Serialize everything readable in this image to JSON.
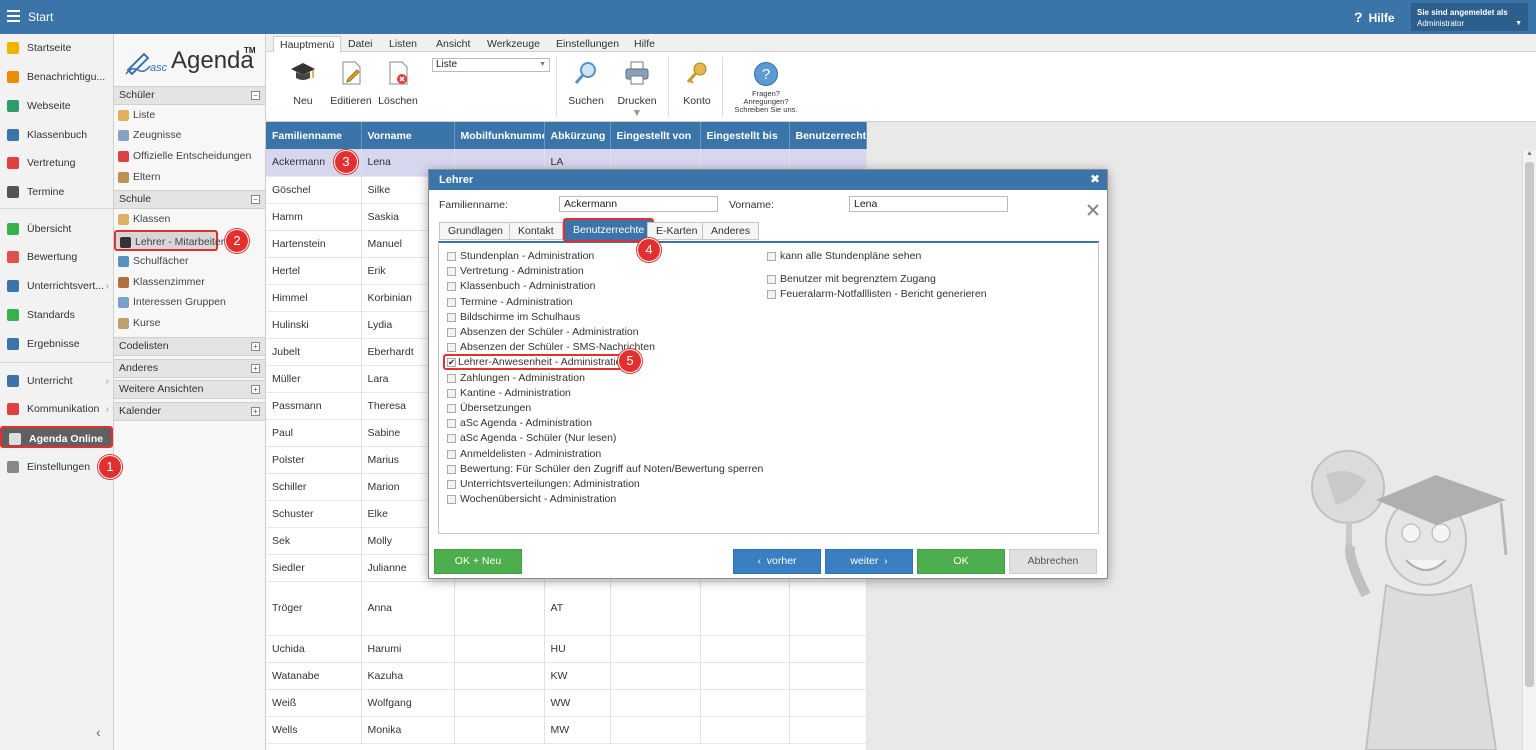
{
  "topbar": {
    "title": "Start",
    "help": "Hilfe",
    "login_caption": "Sie sind angemeldet als",
    "login_user": "Administrator"
  },
  "leftnav": {
    "items": [
      {
        "label": "Startseite",
        "color": "#f0b400"
      },
      {
        "label": "Benachrichtigu...",
        "color": "#f08c00"
      },
      {
        "label": "Webseite",
        "color": "#2e9c6a"
      },
      {
        "label": "Klassenbuch",
        "color": "#3b74a9"
      },
      {
        "label": "Vertretung",
        "color": "#e04040"
      },
      {
        "label": "Termine",
        "color": "#555555"
      },
      {
        "label": "Übersicht",
        "color": "#3ab04a"
      },
      {
        "label": "Bewertung",
        "color": "#e05050"
      },
      {
        "label": "Unterrichtsvert...",
        "color": "#3b74a9"
      },
      {
        "label": "Standards",
        "color": "#3ab04a"
      },
      {
        "label": "Ergebnisse",
        "color": "#3b74a9"
      },
      {
        "label": "Unterricht",
        "color": "#3b74a9"
      },
      {
        "label": "Kommunikation",
        "color": "#e04040"
      },
      {
        "label": "Agenda Online",
        "color": "#dddddd"
      },
      {
        "label": "Einstellungen",
        "color": "#888888"
      }
    ]
  },
  "subnav": {
    "logo_asc": "asc",
    "logo_agenda": "Agenda",
    "logo_tm": "TM",
    "sections": {
      "schueler": "Schüler",
      "schule": "Schule",
      "codelisten": "Codelisten",
      "anderes": "Anderes",
      "weitere": "Weitere Ansichten",
      "kalender": "Kalender"
    },
    "schueler_items": [
      "Liste",
      "Zeugnisse",
      "Offizielle Entscheidungen",
      "Eltern"
    ],
    "schule_items": [
      "Klassen",
      "Lehrer - Mitarbeiter",
      "Schulfächer",
      "Klassenzimmer",
      "Interessen Gruppen",
      "Kurse"
    ]
  },
  "ribbon": {
    "tabs": [
      "Hauptmenü",
      "Datei",
      "Listen",
      "Ansicht",
      "Werkzeuge",
      "Einstellungen",
      "Hilfe"
    ],
    "buttons": {
      "neu": "Neu",
      "editieren": "Editieren",
      "loeschen": "Löschen",
      "suchen": "Suchen",
      "drucken": "Drucken",
      "konto": "Konto"
    },
    "view_select": "Liste",
    "fragen": [
      "Fragen?",
      "Anregungen?",
      "Schreiben Sie uns."
    ]
  },
  "grid": {
    "headers": [
      "Familienname",
      "Vorname",
      "Mobilfunknummer",
      "Abkürzung",
      "Eingestellt von",
      "Eingestellt bis",
      "Benutzerrechte"
    ],
    "rows": [
      [
        "Ackermann",
        "Lena",
        "",
        "LA",
        "",
        "",
        ""
      ],
      [
        "Göschel",
        "Silke",
        "",
        "",
        "",
        "",
        ""
      ],
      [
        "Hamm",
        "Saskia",
        "",
        "",
        "",
        "",
        ""
      ],
      [
        "Hartenstein",
        "Manuel",
        "",
        "",
        "",
        "",
        ""
      ],
      [
        "Hertel",
        "Erik",
        "",
        "",
        "",
        "",
        ""
      ],
      [
        "Himmel",
        "Korbinian",
        "",
        "",
        "",
        "",
        ""
      ],
      [
        "Hulinski",
        "Lydia",
        "",
        "",
        "",
        "",
        ""
      ],
      [
        "Jubelt",
        "Eberhardt",
        "",
        "",
        "",
        "",
        ""
      ],
      [
        "Müller",
        "Lara",
        "",
        "",
        "",
        "",
        ""
      ],
      [
        "Passmann",
        "Theresa",
        "",
        "",
        "",
        "",
        ""
      ],
      [
        "Paul",
        "Sabine",
        "",
        "",
        "",
        "",
        ""
      ],
      [
        "Polster",
        "Marius",
        "",
        "",
        "",
        "",
        ""
      ],
      [
        "Schiller",
        "Marion",
        "",
        "",
        "",
        "",
        ""
      ],
      [
        "Schuster",
        "Elke",
        "",
        "",
        "",
        "",
        ""
      ],
      [
        "Sek",
        "Molly",
        "",
        "",
        "",
        "",
        ""
      ],
      [
        "Siedler",
        "Julianne",
        "",
        "",
        "",
        "",
        ""
      ],
      [
        "Tröger",
        "Anna",
        "",
        "AT",
        "",
        "",
        ""
      ],
      [
        "Uchida",
        "Harumi",
        "",
        "HU",
        "",
        "",
        ""
      ],
      [
        "Watanabe",
        "Kazuha",
        "",
        "KW",
        "",
        "",
        ""
      ],
      [
        "Weiß",
        "Wolfgang",
        "",
        "WW",
        "",
        "",
        ""
      ],
      [
        "Wells",
        "Monika",
        "",
        "MW",
        "",
        "",
        ""
      ]
    ]
  },
  "dialog": {
    "title": "Lehrer",
    "familienname_label": "Familienname:",
    "familienname_value": "Ackermann",
    "vorname_label": "Vorname:",
    "vorname_value": "Lena",
    "tabs": [
      "Grundlagen",
      "Kontakt",
      "Benutzerrechte",
      "E-Karten",
      "Anderes"
    ],
    "perms_left": [
      {
        "label": "Stundenplan - Administration",
        "checked": false
      },
      {
        "label": "Vertretung - Administration",
        "checked": false
      },
      {
        "label": "Klassenbuch - Administration",
        "checked": false
      },
      {
        "label": "Termine - Administration",
        "checked": false
      },
      {
        "label": "Bildschirme im Schulhaus",
        "checked": false
      },
      {
        "label": "Absenzen der Schüler - Administration",
        "checked": false
      },
      {
        "label": "Absenzen der Schüler - SMS-Nachrichten",
        "checked": false
      },
      {
        "label": "Lehrer-Anwesenheit - Administration",
        "checked": true
      },
      {
        "label": "Zahlungen - Administration",
        "checked": false
      },
      {
        "label": "Kantine - Administration",
        "checked": false
      },
      {
        "label": "Übersetzungen",
        "checked": false
      },
      {
        "label": "aSc Agenda - Administration",
        "checked": false
      },
      {
        "label": "aSc Agenda - Schüler (Nur lesen)",
        "checked": false
      },
      {
        "label": "Anmeldelisten - Administration",
        "checked": false
      },
      {
        "label": "Bewertung: Für Schüler den Zugriff auf Noten/Bewertung sperren",
        "checked": false
      },
      {
        "label": "Unterrichtsverteilungen: Administration",
        "checked": false
      },
      {
        "label": "Wochenübersicht - Administration",
        "checked": false
      }
    ],
    "perms_right": [
      {
        "label": "kann alle Stundenpläne sehen",
        "checked": false
      },
      {
        "label": "Benutzer mit begrenztem Zugang",
        "checked": false
      },
      {
        "label": "Feueralarm-Notfalllisten - Bericht generieren",
        "checked": false
      }
    ],
    "buttons": {
      "ok_neu": "OK + Neu",
      "vorher": "vorher",
      "weiter": "weiter",
      "ok": "OK",
      "abbrechen": "Abbrechen"
    }
  },
  "badges": [
    "1",
    "2",
    "3",
    "4",
    "5"
  ]
}
